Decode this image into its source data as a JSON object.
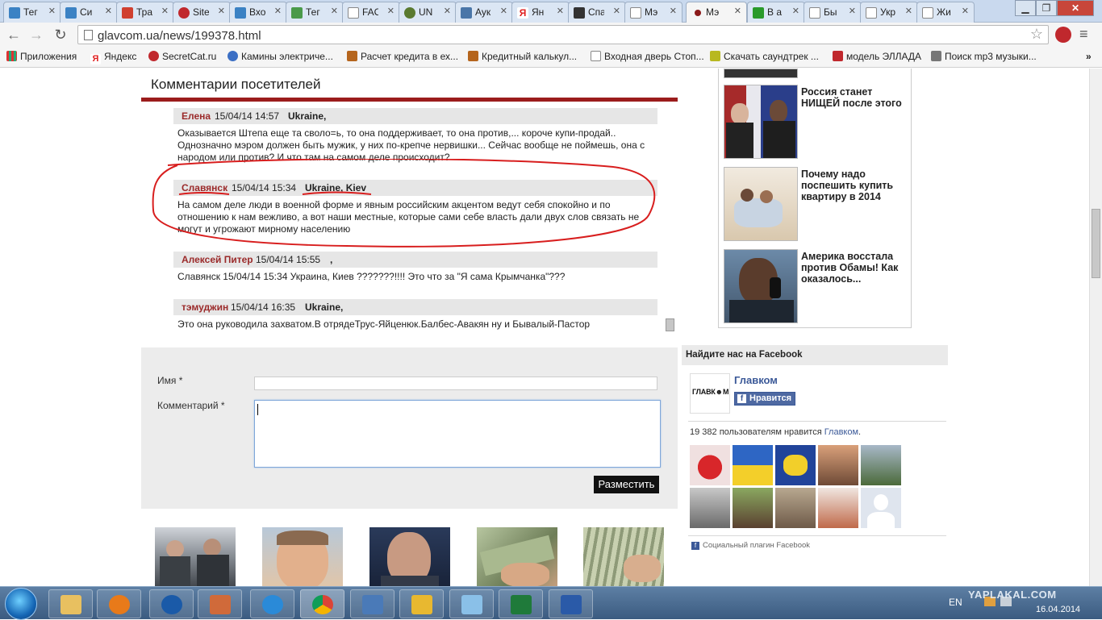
{
  "browser": {
    "tabs": [
      {
        "label": "Тег",
        "color": "#3b82c4"
      },
      {
        "label": "Си",
        "color": "#3b82c4"
      },
      {
        "label": "Тра",
        "color": "#d04030"
      },
      {
        "label": "Site",
        "color": "#c0282d"
      },
      {
        "label": "Вхо",
        "color": "#3b82c4"
      },
      {
        "label": "Тег",
        "color": "#4a9a4a"
      },
      {
        "label": "FAC",
        "color": "#888888"
      },
      {
        "label": "UN",
        "color": "#5a7a30"
      },
      {
        "label": "Аук",
        "color": "#4a76a8"
      },
      {
        "label": "Ян",
        "color": "#e02020"
      },
      {
        "label": "Спа",
        "color": "#333333"
      },
      {
        "label": "Мэ",
        "color": "#888888"
      },
      {
        "label": "Мэ",
        "color": "#8b1a1a"
      },
      {
        "label": "В а",
        "color": "#2a9a2a"
      },
      {
        "label": "Бы",
        "color": "#888888"
      },
      {
        "label": "Укр",
        "color": "#888888"
      },
      {
        "label": "Жи",
        "color": "#888888"
      }
    ],
    "url": "glavcom.ua/news/199378.html",
    "bookmarks": [
      {
        "label": "Приложения",
        "color": "#d33"
      },
      {
        "label": "Яндекс",
        "color": "#e02020"
      },
      {
        "label": "SecretCat.ru",
        "color": "#c0282d"
      },
      {
        "label": "Камины электриче...",
        "color": "#3b6fc4"
      },
      {
        "label": "Расчет кредита в ех...",
        "color": "#b5651d"
      },
      {
        "label": "Кредитный калькул...",
        "color": "#b5651d"
      },
      {
        "label": "Входная дверь Стоп...",
        "color": "#ffffff"
      },
      {
        "label": "Скачать саундтрек ...",
        "color": "#b8b820"
      },
      {
        "label": "модель ЭЛЛАДА",
        "color": "#c0282d"
      },
      {
        "label": "Поиск mp3 музыки...",
        "color": "#777777"
      }
    ],
    "more_bookmarks": "»"
  },
  "comments": {
    "title": "Комментарии посетителей",
    "items": [
      {
        "author": "Елена",
        "date": "15/04/14 14:57",
        "location": "Ukraine,",
        "text": "Оказывается Штепа еще та своло=ь, то она поддерживает, то она против,... короче купи-продай.. Однозначно мэром должен быть мужик, у них по-крепче нервишки... Сейчас вообще не поймешь, она с народом или против? И что там на самом деле происходит?"
      },
      {
        "author": "Славянск",
        "date": "15/04/14 15:34",
        "location": "Ukraine, Kiev",
        "text": "На самом деле люди в военной форме и явным российским акцентом ведут себя спокойно и по отношению к нам вежливо, а вот наши местные, которые сами себе власть дали двух слов связать не могут и угрожают мирному населению"
      },
      {
        "author": "Алексей Питер",
        "date": "15/04/14 15:55",
        "location": ",",
        "text": "Славянск 15/04/14 15:34 Украина, Киев ???????!!!! Это что за \"Я сама Крымчанка\"???"
      },
      {
        "author": "тэмуджин",
        "date": "15/04/14 16:35",
        "location": "Ukraine,",
        "text": "Это она руководила захватом.В отрядеТрус-Яйценюк.Балбес-Авакян ну и Бывалый-Пастор"
      }
    ]
  },
  "form": {
    "name_label": "Имя *",
    "comment_label": "Комментарий *",
    "submit_label": "Разместить"
  },
  "sidebar": {
    "news": [
      {
        "title": "Россия станет НИЩЕЙ после этого"
      },
      {
        "title": "Почему надо поспешить купить квартиру в 2014"
      },
      {
        "title": "Америка восстала против Обамы! Как оказалось..."
      }
    ],
    "facebook": {
      "heading": "Найдите нас на Facebook",
      "page_name": "Главком",
      "logo_text": "ГЛАВК☻М",
      "like_label": "Нравится",
      "likes_prefix": "19 382 пользователям нравится ",
      "likes_link": "Главком",
      "likes_suffix": ".",
      "plugin_label": "Социальный плагин Facebook"
    }
  },
  "taskbar": {
    "language": "EN",
    "date": "16.04.2014",
    "watermark": "YAPLAKAL.COM"
  }
}
